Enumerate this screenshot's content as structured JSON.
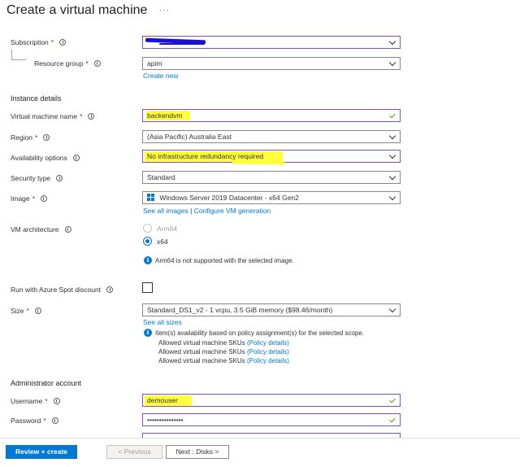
{
  "page": {
    "title": "Create a virtual machine",
    "more": "···"
  },
  "subscription": {
    "label": "Subscription",
    "value": ""
  },
  "resource_group": {
    "label": "Resource group",
    "value": "apim",
    "create_new": "Create new"
  },
  "instance_details": {
    "heading": "Instance details",
    "vm_name": {
      "label": "Virtual machine name",
      "value": "backendvm"
    },
    "region": {
      "label": "Region",
      "value": "(Asia Pacific) Australia East"
    },
    "availability": {
      "label": "Availability options",
      "value": "No infrastructure redundancy required"
    },
    "security_type": {
      "label": "Security type",
      "value": "Standard"
    },
    "image": {
      "label": "Image",
      "value": "Windows Server 2019 Datacenter - x64 Gen2",
      "see_all": "See all images",
      "separator": "|",
      "configure": "Configure VM generation"
    },
    "architecture": {
      "label": "VM architecture",
      "options": [
        "Arm64",
        "x64"
      ],
      "selected": "x64",
      "note": "Arm64 is not supported with the selected image."
    },
    "spot": {
      "label": "Run with Azure Spot discount",
      "checked": false
    },
    "size": {
      "label": "Size",
      "value": "Standard_DS1_v2 - 1 vcpu, 3.5 GiB memory ($98.46/month)",
      "see_all": "See all sizes",
      "note": "Item(s) availability based on policy assignment(s) for the selected scope.",
      "policy_lines": [
        {
          "text": "Allowed virtual machine SKUs",
          "link": "(Policy details)"
        },
        {
          "text": "Allowed virtual machine SKUs",
          "link": "(Policy details)"
        },
        {
          "text": "Allowed virtual machine SKUs",
          "link": "(Policy details)"
        }
      ]
    }
  },
  "admin": {
    "heading": "Administrator account",
    "username": {
      "label": "Username",
      "value": "demouser"
    },
    "password": {
      "label": "Password",
      "value": "•••••••••••••••"
    }
  },
  "footer": {
    "review_create": "Review + create",
    "previous": "< Previous",
    "next": "Next : Disks >"
  },
  "colors": {
    "accent": "#0078d4",
    "required": "#a4262c",
    "valid": "#57a300",
    "highlight": "#ffff3d",
    "focus_border": "#8a4bc7"
  }
}
